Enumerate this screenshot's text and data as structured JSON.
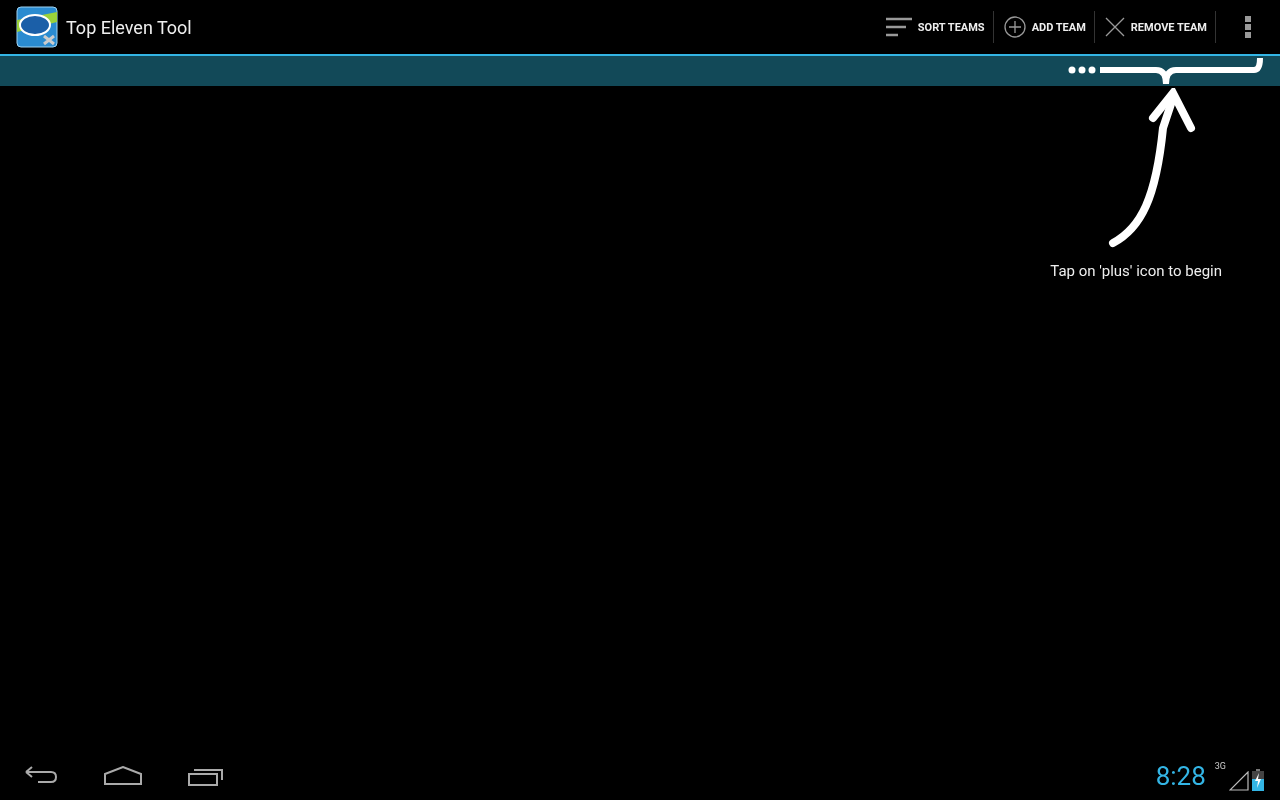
{
  "action_bar": {
    "title": "Top Eleven Tool",
    "actions": [
      {
        "kind": "sort",
        "label": "SORT TEAMS"
      },
      {
        "kind": "add",
        "label": "ADD TEAM"
      },
      {
        "kind": "remove",
        "label": "REMOVE TEAM"
      }
    ]
  },
  "hint": {
    "text": "Tap on 'plus' icon to begin"
  },
  "system_bar": {
    "clock": "8:28",
    "network": "3G"
  }
}
